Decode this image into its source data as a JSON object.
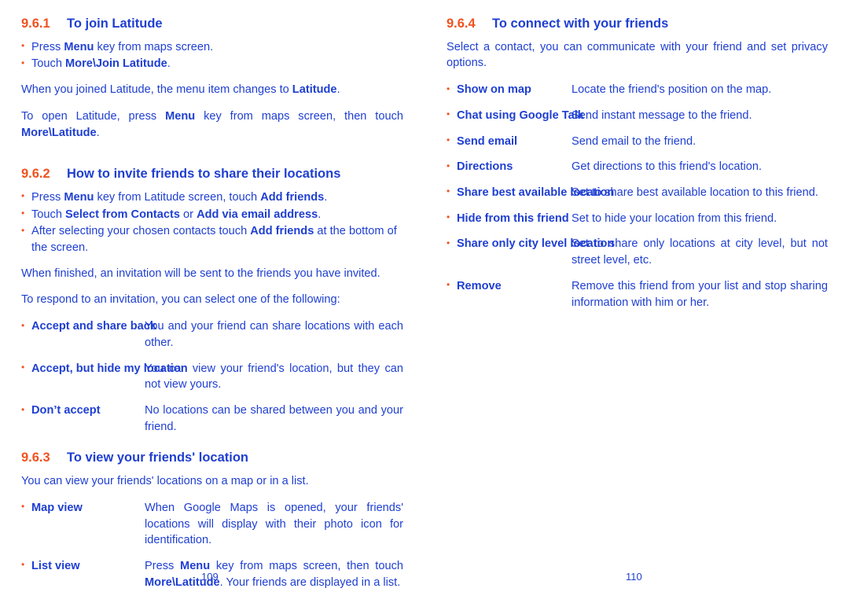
{
  "colors": {
    "heading_number": "#f0521f",
    "bullet": "#f0521f",
    "text": "#1f3fd1",
    "background": "#ffffff"
  },
  "left_page": {
    "folio": "109",
    "sections": [
      {
        "number": "9.6.1",
        "title": "To join Latitude",
        "bullets": [
          {
            "pre": "Press ",
            "bold": "Menu",
            "post": " key from maps screen."
          },
          {
            "pre": "Touch ",
            "bold": "More\\Join Latitude",
            "post": "."
          }
        ],
        "paragraphs": [
          {
            "pre": "When you joined Latitude, the menu item changes to ",
            "bold": "Latitude",
            "post": "."
          },
          {
            "pre": "To open Latitude, press ",
            "bold": "Menu",
            "mid": " key from maps screen, then touch ",
            "bold2": "More\\Latitude",
            "post": "."
          }
        ]
      },
      {
        "number": "9.6.2",
        "title": "How to invite friends to share their locations",
        "bullets": [
          {
            "pre": "Press ",
            "bold": "Menu",
            "mid": " key from Latitude screen, touch ",
            "bold2": "Add friends",
            "post": "."
          },
          {
            "pre": "Touch ",
            "bold": "Select from Contacts",
            "mid": " or ",
            "bold2": "Add via email address",
            "post": "."
          },
          {
            "pre": "After selecting your chosen contacts touch ",
            "bold": "Add friends",
            "post": " at the bottom of the screen."
          }
        ],
        "paragraphs": [
          {
            "pre": "When finished, an invitation will be sent to the friends you have invited."
          },
          {
            "pre": "To respond to an invitation, you can select one of the following:"
          }
        ],
        "definitions": [
          {
            "term": "Accept and share back",
            "desc": "You and your friend can share locations with each other."
          },
          {
            "term": "Accept, but hide my location",
            "desc": "You can view your friend's location, but they can not view yours."
          },
          {
            "term": "Don’t accept",
            "desc": "No locations can be shared between you and your friend."
          }
        ]
      },
      {
        "number": "9.6.3",
        "title": "To view your friends' location",
        "paragraphs": [
          {
            "pre": "You can view your friends' locations on a map or in a list."
          }
        ],
        "definitions": [
          {
            "term": "Map view",
            "desc": "When Google Maps is opened, your friends' locations will display with their photo icon for identification."
          },
          {
            "term": "List view",
            "pre": "Press ",
            "bold": "Menu",
            "mid": " key from maps screen, then touch ",
            "bold2": "More\\Latitude",
            "post": ". Your friends are displayed in a list."
          }
        ]
      }
    ]
  },
  "right_page": {
    "folio": "110",
    "sections": [
      {
        "number": "9.6.4",
        "title": "To connect with your friends",
        "paragraphs": [
          {
            "pre": "Select a contact, you can communicate with your friend and set privacy options."
          }
        ],
        "definitions": [
          {
            "term": "Show on map",
            "desc": "Locate the friend's position on the map."
          },
          {
            "term": "Chat using Google Talk",
            "desc": "Send instant message to the friend."
          },
          {
            "term": "Send email",
            "desc": "Send email to the friend."
          },
          {
            "term": "Directions",
            "desc": "Get directions to this friend's location."
          },
          {
            "term": "Share best available location",
            "desc": "Set to share best available location to this friend."
          },
          {
            "term": "Hide from this friend",
            "desc": "Set to hide your location from this friend."
          },
          {
            "term": "Share only city level location",
            "desc": "Set to share only locations at city level, but not street level, etc."
          },
          {
            "term": "Remove",
            "desc": "Remove this friend from your list and stop sharing information with him or her."
          }
        ]
      }
    ]
  }
}
